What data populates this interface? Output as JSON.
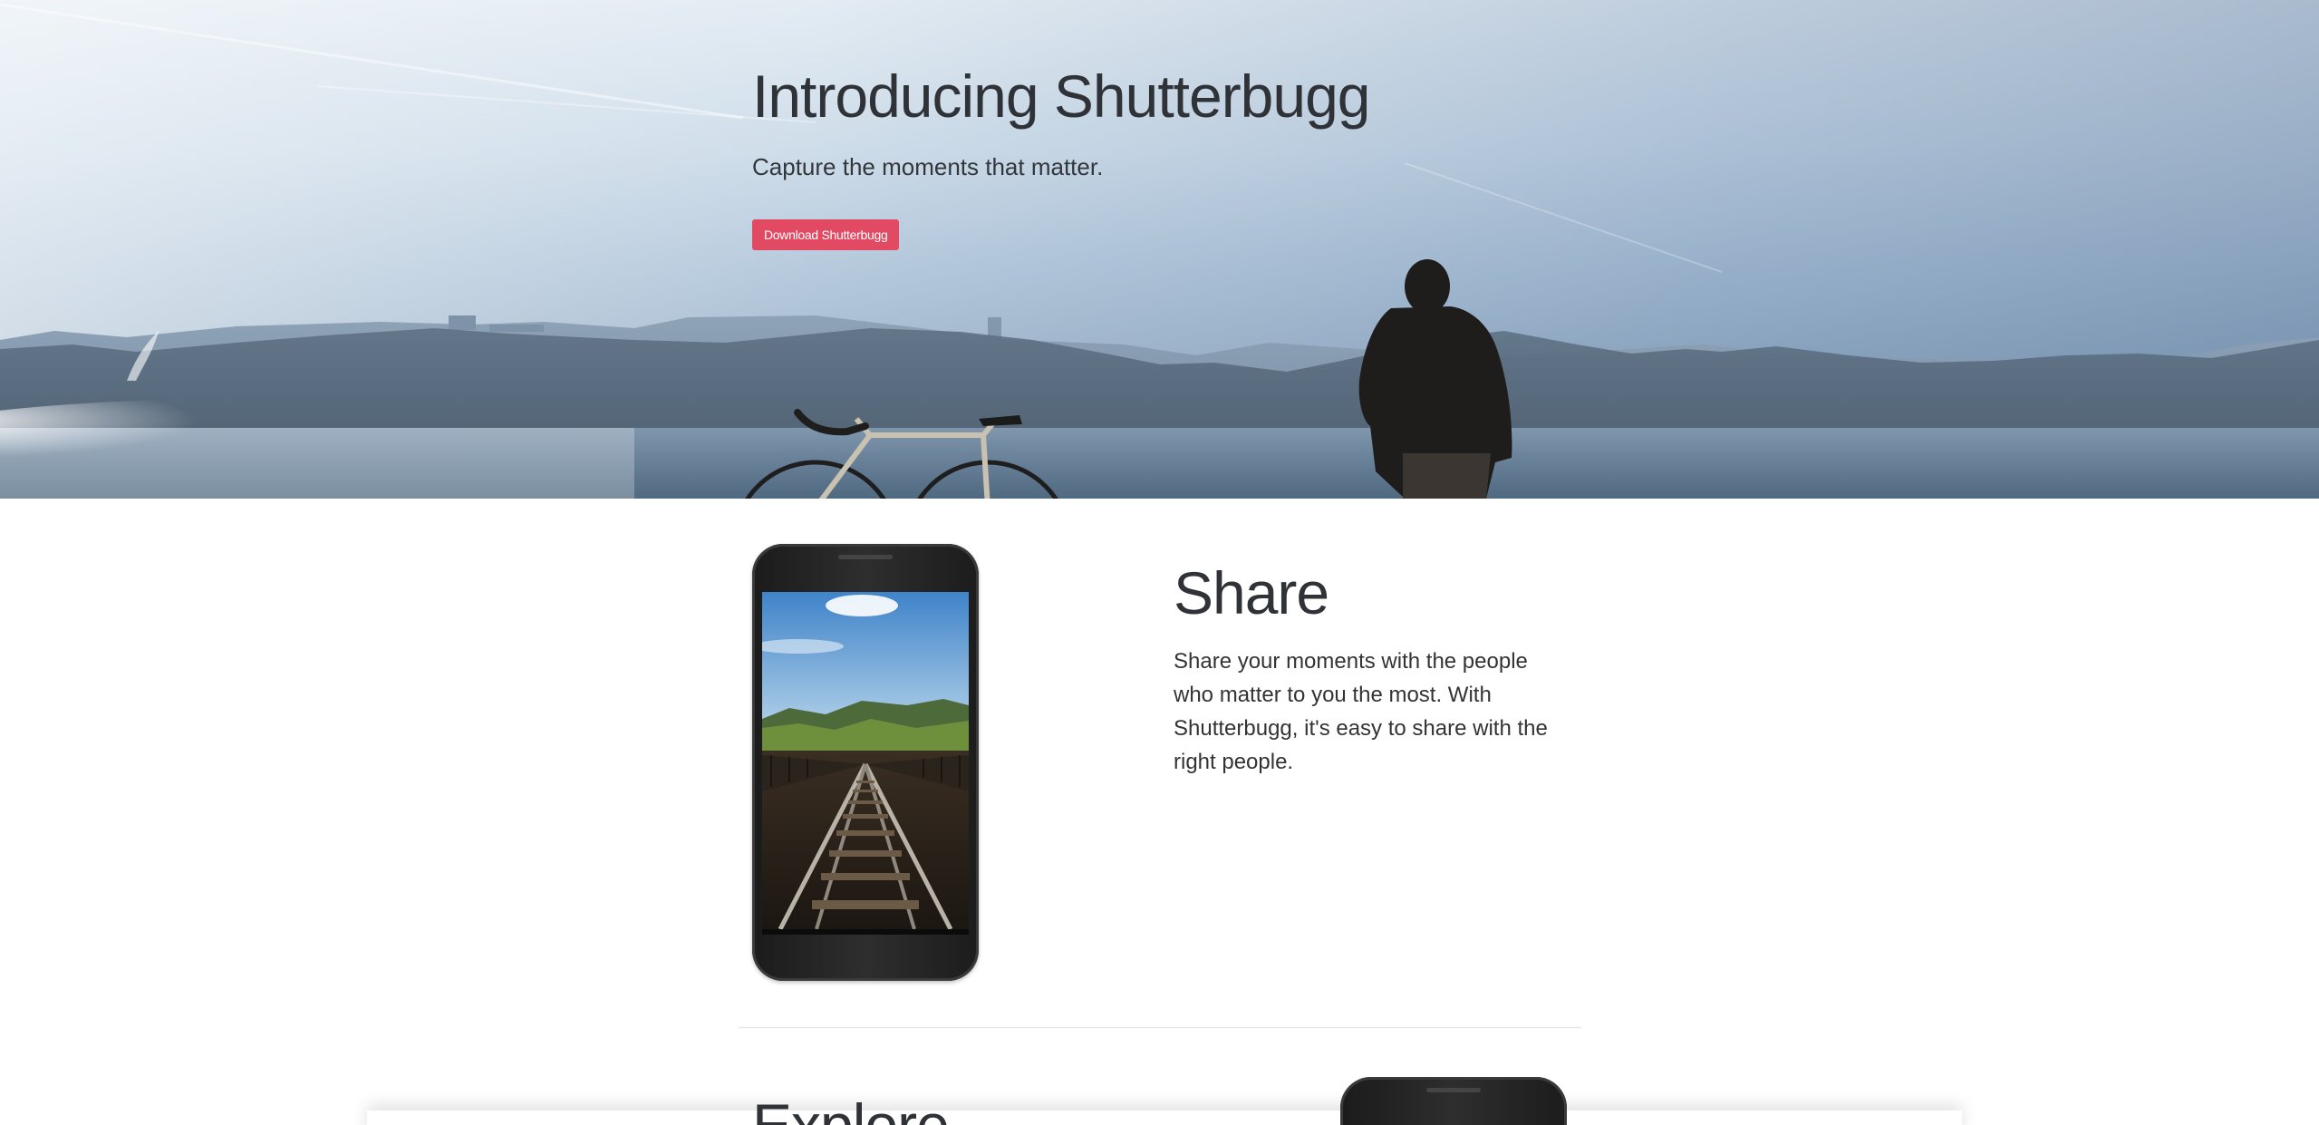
{
  "hero": {
    "title": "Introducing Shutterbugg",
    "subtitle": "Capture the moments that matter.",
    "button_label": "Download Shutterbugg",
    "accent_color": "#e24a64"
  },
  "feature_share": {
    "title": "Share",
    "description": "Share your moments with the people who matter to you the most. With Shutterbugg, it's easy to share with the right people."
  },
  "feature_explore": {
    "title": "Explore"
  }
}
